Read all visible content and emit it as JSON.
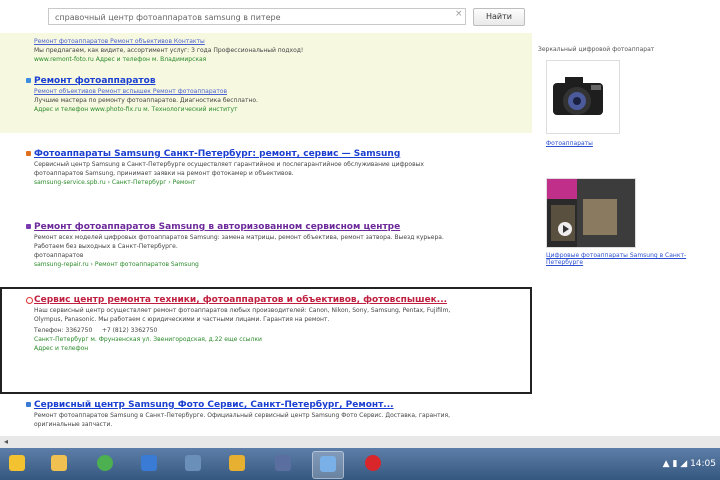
{
  "search": {
    "query": "справочный центр фотоаппаратов samsung в питере",
    "clear_glyph": "×",
    "button_label": "Найти"
  },
  "ads": [
    {
      "sitelinks": "Ремонт фотоаппаратов   Ремонт объективов   Контакты",
      "snippet": "Мы предлагаем, как видите, ассортимент услуг: 3 года Профессиональный подход!",
      "url": "www.remont-foto.ru   Адрес и телефон   м. Владимирская"
    },
    {
      "title": "Ремонт фотоаппаратов",
      "sitelinks": "Ремонт объективов   Ремонт вспышек   Ремонт фотоаппаратов",
      "snippet": "Лучшие мастера по ремонту фотоаппаратов. Диагностика бесплатно.",
      "url": "Адрес и телефон   www.photo-fix.ru   м. Технологический институт"
    }
  ],
  "results": [
    {
      "title": "Фотоаппараты Samsung Санкт-Петербург: ремонт, сервис — Samsung",
      "snippet": "Сервисный центр Samsung в Санкт-Петербурге осуществляет гарантийное и послегарантийное обслуживание цифровых фотоаппаратов Samsung, принимает заявки на ремонт фотокамер и объективов.",
      "url": "samsung-service.spb.ru › Санкт-Петербург › Ремонт"
    },
    {
      "title": "Ремонт фотоаппаратов Samsung в авторизованном сервисном центре",
      "snippet": "Ремонт всех моделей цифровых фотоаппаратов Samsung: замена матрицы, ремонт объектива, ремонт затвора. Выезд курьера. Работаем без выходных в Санкт-Петербурге.",
      "extra": "фотоаппаратов",
      "url": "samsung-repair.ru › Ремонт фотоаппаратов Samsung"
    },
    {
      "title": "Сервис центр ремонта техники, фотоаппаратов и объективов, фотовспышек...",
      "snippet": "Наш сервисный центр осуществляет ремонт фотоаппаратов любых производителей: Canon, Nikon, Sony, Samsung, Pentax, Fujifilm, Olympus, Panasonic. Мы работаем с юридическими и частными лицами. Гарантия на ремонт.",
      "phone1": "Телефон: 3362750",
      "phone2": "+7 (812) 3362750",
      "url": "Санкт-Петербург   м. Фрунзенская   ул. Звенигородская, д.22   еще ссылки",
      "more": "Адрес и телефон"
    },
    {
      "title": "Сервисный центр Samsung Фото Сервис, Санкт-Петербург, Ремонт...",
      "snippet": "Ремонт фотоаппаратов Samsung в Санкт-Петербурге. Официальный сервисный центр Samsung Фото Сервис. Доставка, гарантия, оригинальные запчасти."
    }
  ],
  "side": {
    "card1_label": "Зеркальный цифровой фотоаппарат",
    "card1_link": "Фотоаппараты",
    "card2_caption": "Цифровые фотоаппараты Samsung в Санкт-Петербурге"
  },
  "taskbar": {
    "clock": "14:05",
    "colors": {
      "start": "#f2c230",
      "explorer": "#f0c050",
      "chrome": "#4caf50",
      "app3": "#3a7bd5",
      "app4": "#6a8fb8",
      "app5": "#e8b030",
      "app6": "#5a6fa0",
      "app7": "#7ab0e8",
      "app8": "#d8262a"
    }
  }
}
